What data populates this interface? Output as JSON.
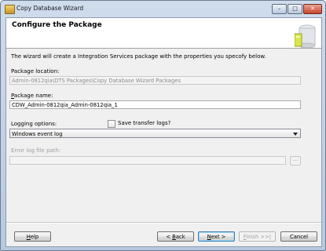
{
  "window": {
    "title": "Copy Database Wizard",
    "controls": {
      "minimize": "–",
      "maximize": "□",
      "close": "✕"
    }
  },
  "header": {
    "title": "Configure the Package"
  },
  "description": "The wizard will create a Integration Services package with the properties you specofy below.",
  "package_location": {
    "label": "Package location:",
    "value": "Admin-0812qia\\DTS Packages\\Copy Database Wizard Packages"
  },
  "package_name": {
    "label_u": "P",
    "label_rest": "ackage name:",
    "value": "CDW_Admin-0812qia_Admin-0812qia_1"
  },
  "logging": {
    "label": "Logging options:",
    "selected": "Windows event log",
    "save_transfer_logs": "Save transfer logs?",
    "save_transfer_logs_checked": false
  },
  "error_log": {
    "label": "Error log file path:",
    "value": "",
    "browse": "..."
  },
  "buttons": {
    "help_u": "H",
    "help_rest": "elp",
    "back_prefix": "< ",
    "back_u": "B",
    "back_rest": "ack",
    "next_u": "N",
    "next_rest": "ext >",
    "finish_u": "F",
    "finish_rest": "inish >>|",
    "cancel": "Cancel"
  },
  "colors": {
    "accent": "#3c7fb1",
    "title_bar": "#c3d3e6",
    "dialog_bg": "#f0f0f0"
  }
}
